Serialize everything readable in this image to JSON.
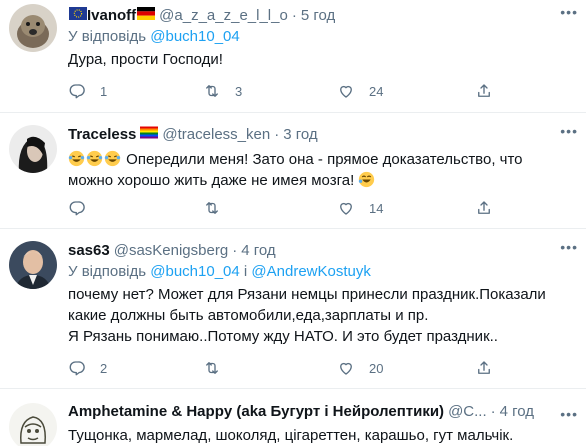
{
  "tweets": [
    {
      "name": "Ivanoff",
      "handle": "@a_z_a_z_e_l_l_o",
      "time": "5 год",
      "reply_label": "У відповідь",
      "reply_mention": "@buch10_04",
      "text": "Дура, прости Господи!",
      "replies": "1",
      "retweets": "3",
      "likes": "24"
    },
    {
      "name": "Traceless",
      "handle": "@traceless_ken",
      "time": "3 год",
      "text": "Опередили меня! Зато она - прямое доказательство, что можно хорошо жить даже не имея мозга!",
      "replies": "",
      "retweets": "",
      "likes": "14"
    },
    {
      "name": "sas63",
      "handle": "@sasKenigsberg",
      "time": "4 год",
      "reply_label": "У відповідь",
      "reply_mention": "@buch10_04",
      "reply_and": "і",
      "reply_mention2": "@AndrewKostuyk",
      "text_line1": "почему нет? Может для Рязани немцы принесли праздник.Показали какие должны быть автомобили,еда,зарплаты и пр.",
      "text_line2": "Я Рязань понимаю..Потому жду НАТО. И это будет праздник..",
      "replies": "2",
      "retweets": "",
      "likes": "20"
    },
    {
      "name": "Amphetamine & Happy (aka Бугурт і Нейролептики)",
      "handle": "@C...",
      "time": "4 год",
      "text": "Тущонка, мармелад, шоколяд, цігареттен, карашьо, гут мальчік."
    }
  ],
  "icons": {
    "reply": "comment-icon",
    "retweet": "retweet-icon",
    "like": "heart-icon",
    "share": "share-icon",
    "more": "more-icon"
  },
  "colors": {
    "text": "#0f1419",
    "secondary": "#5b7083",
    "link": "#1da1f2",
    "divider": "#ebeef0"
  }
}
